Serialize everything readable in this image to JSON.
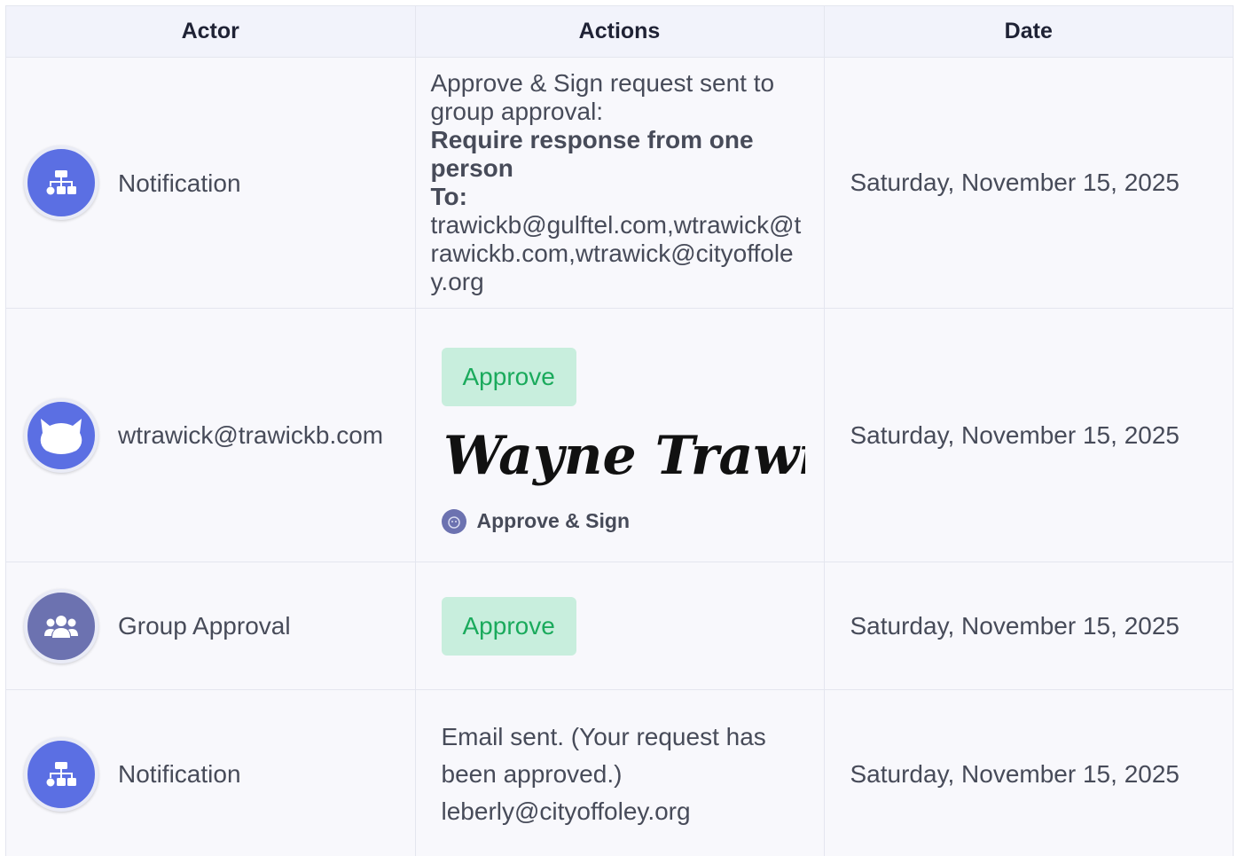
{
  "columns": {
    "actor": "Actor",
    "actions": "Actions",
    "date": "Date"
  },
  "rows": [
    {
      "actor": "Notification",
      "avatar_icon": "sitemap-icon",
      "action_intro": "Approve & Sign request sent to group approval:",
      "action_bold": "Require response from one person",
      "action_to_label": "To:",
      "action_emails": "trawickb@gulftel.com,wtrawick@trawickb.com,wtrawick@cityoffoley.org",
      "date": "Saturday, November 15, 2025"
    },
    {
      "actor": "wtrawick@trawickb.com",
      "avatar_icon": "cat-icon",
      "status": "Approve",
      "signature": "Wayne Trawick",
      "sign_label": "Approve & Sign",
      "date": "Saturday, November 15, 2025"
    },
    {
      "actor": "Group Approval",
      "avatar_icon": "users-icon",
      "status": "Approve",
      "date": "Saturday, November 15, 2025"
    },
    {
      "actor": "Notification",
      "avatar_icon": "sitemap-icon",
      "action_text": "Email sent. (Your request has been approved.) leberly@cityoffoley.org",
      "date": "Saturday, November 15, 2025"
    }
  ],
  "colors": {
    "avatar_blue": "#5b6fe3",
    "avatar_group": "#6c72b0",
    "approve_bg": "#c8eedd",
    "approve_text": "#1aaa5c"
  }
}
